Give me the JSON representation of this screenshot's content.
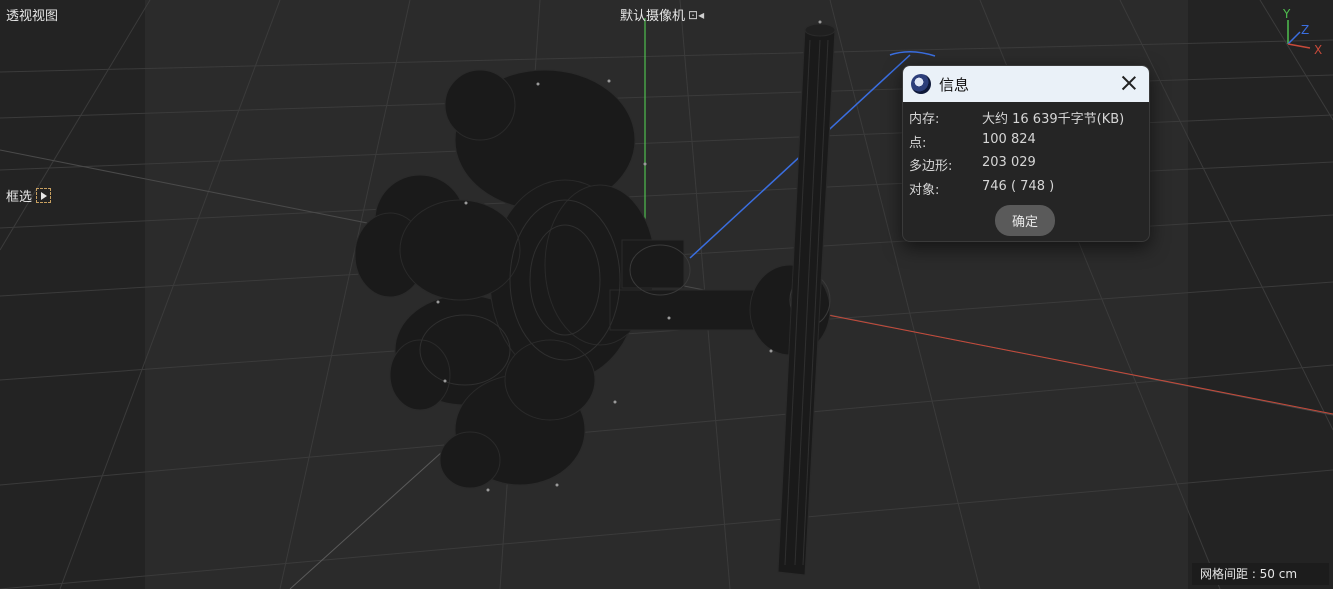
{
  "viewport": {
    "title": "透视视图",
    "camera_label": "默认摄像机",
    "camera_icon": "camera-lock-icon",
    "selection_mode": "框选",
    "grid_spacing": "网格间距 : 50 cm",
    "axis_gizmo": {
      "y": "Y",
      "z": "Z",
      "x": "X"
    },
    "colors": {
      "x_axis": "#c84a3a",
      "y_axis": "#4fbf4f",
      "z_axis": "#3a6ee0"
    }
  },
  "dialog": {
    "title": "信息",
    "rows": [
      {
        "label": "内存:",
        "value": "大约 16 639千字节(KB)"
      },
      {
        "label": "点:",
        "value": "100 824"
      },
      {
        "label": "多边形:",
        "value": "203 029"
      },
      {
        "label": "对象:",
        "value": "746 ( 748 )"
      }
    ],
    "ok_label": "确定"
  }
}
